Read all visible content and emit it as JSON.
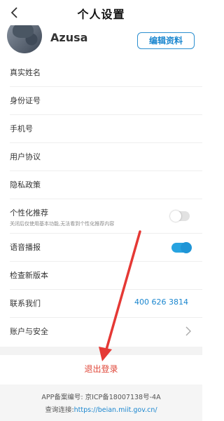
{
  "header": {
    "title": "个人设置"
  },
  "profile": {
    "username": "Azusa",
    "edit_label": "编辑资料"
  },
  "settings": {
    "real_name": "真实姓名",
    "id_number": "身份证号",
    "phone": "手机号",
    "user_agreement": "用户协议",
    "privacy_policy": "隐私政策",
    "personalized_label": "个性化推荐",
    "personalized_desc": "关闭后仅使用基本功能,无法看到个性化推荐内容",
    "personalized_enabled": false,
    "voice_label": "语音播报",
    "voice_enabled": true,
    "check_update": "检查新版本",
    "contact_label": "联系我们",
    "contact_phone": "400 626 3814",
    "account_security": "账户与安全"
  },
  "logout_label": "退出登录",
  "footer": {
    "beian": "APP备案编号: 京ICP备18007138号-4A",
    "query_prefix": "查询连接:",
    "query_link": "https://beian.miit.gov.cn/"
  },
  "colors": {
    "accent": "#1a86cf",
    "logout": "#e0483a",
    "annotation_arrow": "#e53935"
  }
}
